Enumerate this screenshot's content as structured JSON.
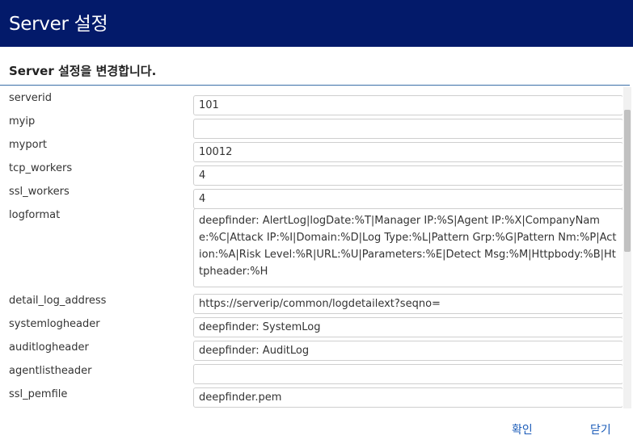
{
  "dialog": {
    "title": "Server 설정",
    "subtitle": "Server 설정을 변경합니다."
  },
  "fields": [
    {
      "label": "serverid",
      "value": "101"
    },
    {
      "label": "myip",
      "value": ""
    },
    {
      "label": "myport",
      "value": "10012"
    },
    {
      "label": "tcp_workers",
      "value": "4"
    },
    {
      "label": "ssl_workers",
      "value": "4"
    },
    {
      "label": "logformat",
      "value": "deepfinder: AlertLog|logDate:%T|Manager IP:%S|Agent IP:%X|CompanyName:%C|Attack IP:%I|Domain:%D|Log Type:%L|Pattern Grp:%G|Pattern Nm:%P|Action:%A|Risk Level:%R|URL:%U|Parameters:%E|Detect Msg:%M|Httpbody:%B|Httpheader:%H"
    },
    {
      "label": "detail_log_address",
      "value": "https://serverip/common/logdetailext?seqno="
    },
    {
      "label": "systemlogheader",
      "value": "deepfinder: SystemLog"
    },
    {
      "label": "auditlogheader",
      "value": "deepfinder: AuditLog"
    },
    {
      "label": "agentlistheader",
      "value": ""
    },
    {
      "label": "ssl_pemfile",
      "value": "deepfinder.pem"
    }
  ],
  "buttons": {
    "ok_label": "확인",
    "close_label": "닫기"
  },
  "colors": {
    "titlebar": "#031a6a",
    "link": "#1a5bb8",
    "divider": "#3a6ea8"
  }
}
